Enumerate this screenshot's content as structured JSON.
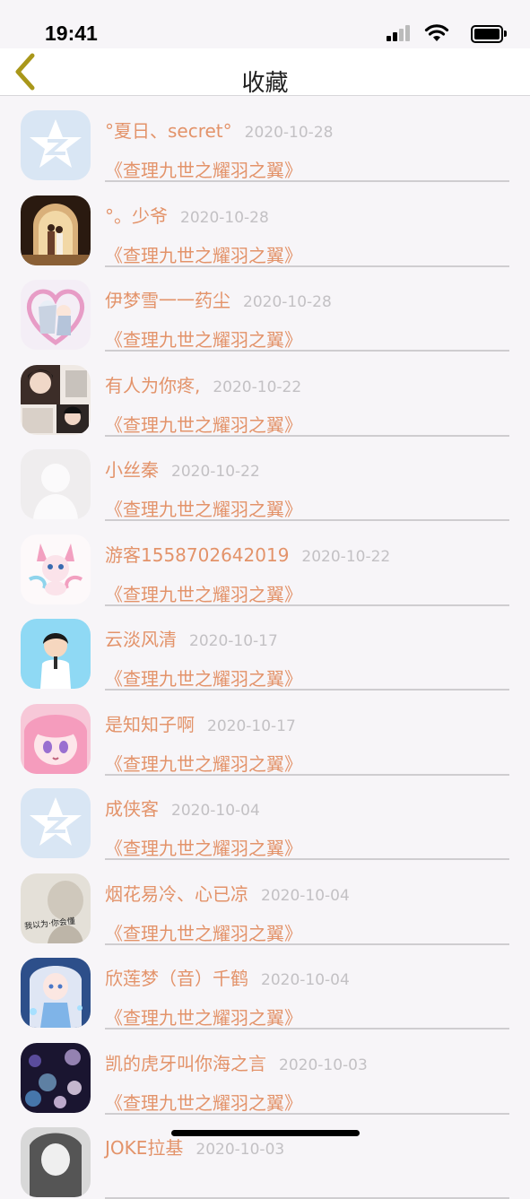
{
  "status": {
    "time": "19:41"
  },
  "nav": {
    "title": "收藏"
  },
  "items": [
    {
      "name": "°夏日、secret°",
      "date": "2020-10-28",
      "book": "《查理九世之耀羽之翼》",
      "avatar": "qq-default-avatar"
    },
    {
      "name": "°。少爷",
      "date": "2020-10-28",
      "book": "《查理九世之耀羽之翼》",
      "avatar": "archway-couple-avatar"
    },
    {
      "name": "伊梦雪一一药尘",
      "date": "2020-10-28",
      "book": "《查理九世之耀羽之翼》",
      "avatar": "anime-heart-avatar"
    },
    {
      "name": "有人为你疼,",
      "date": "2020-10-22",
      "book": "《查理九世之耀羽之翼》",
      "avatar": "collage-photo-avatar"
    },
    {
      "name": "小丝秦",
      "date": "2020-10-22",
      "book": "《查理九世之耀羽之翼》",
      "avatar": "silhouette-avatar"
    },
    {
      "name": "游客1558702642019",
      "date": "2020-10-22",
      "book": "《查理九世之耀羽之翼》",
      "avatar": "pink-pokemon-avatar"
    },
    {
      "name": "云淡风清",
      "date": "2020-10-17",
      "book": "《查理九世之耀羽之翼》",
      "avatar": "cartoon-boy-avatar"
    },
    {
      "name": "是知知子啊",
      "date": "2020-10-17",
      "book": "《查理九世之耀羽之翼》",
      "avatar": "anime-pink-girl-avatar"
    },
    {
      "name": "成侠客",
      "date": "2020-10-04",
      "book": "《查理九世之耀羽之翼》",
      "avatar": "qq-default-avatar"
    },
    {
      "name": "烟花易冷、心已凉",
      "date": "2020-10-04",
      "book": "《查理九世之耀羽之翼》",
      "avatar": "text-photo-avatar",
      "avatar_text": "我以为·你会懂"
    },
    {
      "name": "欣莲梦（音）千鹤",
      "date": "2020-10-04",
      "book": "《查理九世之耀羽之翼》",
      "avatar": "anime-blue-girl-avatar"
    },
    {
      "name": "凯的虎牙叫你海之言",
      "date": "2020-10-03",
      "book": "《查理九世之耀羽之翼》",
      "avatar": "night-bokeh-avatar"
    },
    {
      "name": "JOKE拉基",
      "date": "2020-10-03",
      "book": "",
      "avatar": "sketch-avatar"
    }
  ]
}
